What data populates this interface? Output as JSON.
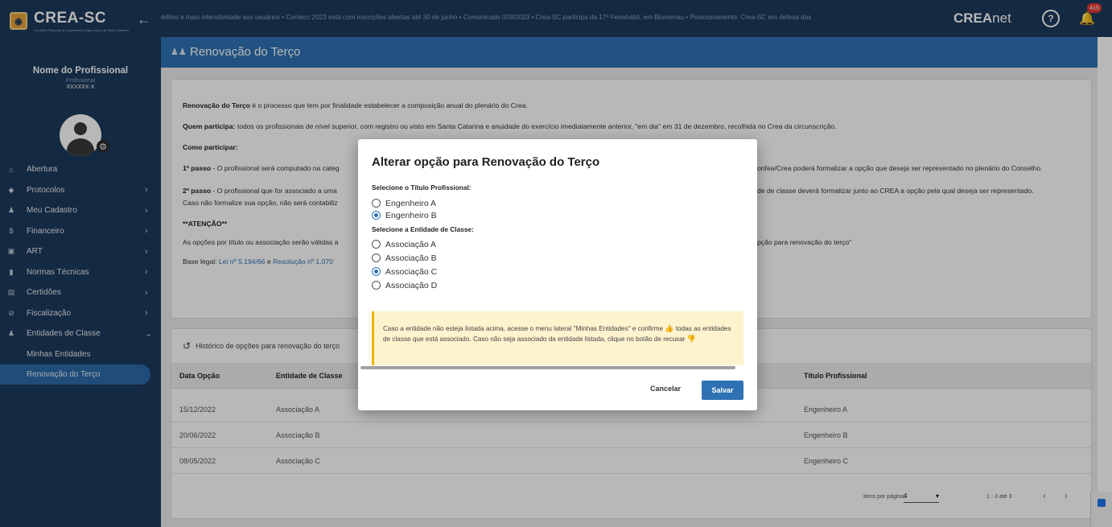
{
  "app": {
    "brand_logo": "CREA-SC",
    "brand_subtitle": "Conselho Regional de Engenharia e Agronomia de Santa Catarina"
  },
  "header": {
    "ticker": "éditos e mais interatividade aos usuários • Contecc 2023 está com inscrições abertas até 30 de junho • Comunicado 003/2023 • Crea-SC participa da 17ª Fenahabit, em Blumenau • Posicionamento: Crea-SC em defesa dos",
    "brand_bold": "CREA",
    "brand_light": "net",
    "notification_count": "415"
  },
  "profile": {
    "name": "Nome do Profissional",
    "role": "Profissional",
    "registration": "XXXXXX-X"
  },
  "sidebar": {
    "items": [
      {
        "label": "Abertura",
        "icon": "home-icon"
      },
      {
        "label": "Protocolos",
        "icon": "diamond-icon"
      },
      {
        "label": "Meu Cadastro",
        "icon": "user-icon"
      },
      {
        "label": "Financeiro",
        "icon": "dollar-icon"
      },
      {
        "label": "ART",
        "icon": "document-icon"
      },
      {
        "label": "Normas Técnicas",
        "icon": "file-icon"
      },
      {
        "label": "Certidões",
        "icon": "certificate-icon"
      },
      {
        "label": "Fiscalização",
        "icon": "compass-icon"
      },
      {
        "label": "Entidades de Classe",
        "icon": "group-icon"
      }
    ],
    "subitems": [
      "Minhas Entidades",
      "Renovação do Terço"
    ]
  },
  "page": {
    "title": "Renovação do Terço"
  },
  "info": {
    "p1_bold": "Renovação do Terço",
    "p1": " é o processo que tem por finalidade estabelecer a composição anual do plenário do Crea.",
    "p2_bold": "Quem participa:",
    "p2": " todos os profissionais de nível superior, com registro ou visto em Santa Catarina e anuidade do exercício imediatamente anterior, \"em dia\" em 31 de dezembro, recolhida no Crea da circunscrição.",
    "p3_bold": "Como participar:",
    "p4_bold": "1º passo",
    "p4a": " - O profissional será computado na categ",
    "p4b": "onfea/Crea poderá formalizar a opção que deseja ser representado no plenário do Conselho.",
    "p5_bold": "2º passo",
    "p5a": " - O profissional que for associado a uma",
    "p5b": "de de classe deverá formalizar junto ao CREA a opção pela qual deseja ser representado.",
    "p6": "Caso não formalize sua opção, não será contabiliz",
    "p7_bold": "**ATENÇÃO**",
    "p8a": "As opções por título ou associação serão válidas a",
    "p8b": "pção para renovação do terço\"",
    "p9a": "Base legal: ",
    "p9_link1": "Lei nº 5.194/66",
    "p9_mid": " e ",
    "p9_link2": "Resolução nº 1.070"
  },
  "history": {
    "title": "Histórico de opções para renovação do terço",
    "columns": [
      "Data Opção",
      "Entidade de Classe",
      "Título Profissional"
    ],
    "rows": [
      {
        "date": "15/12/2022",
        "entity": "Associação A",
        "title": "Engenheiro A"
      },
      {
        "date": "20/06/2022",
        "entity": "Associação B",
        "title": "Engenheiro B"
      },
      {
        "date": "08/05/2022",
        "entity": "Associação C",
        "title": "Engenheiro C"
      }
    ],
    "pager": {
      "items_label": "Itens por página:",
      "page_size": "4",
      "range": "1 - 3 até 3"
    }
  },
  "modal": {
    "title": "Alterar opção para Renovação do Terço",
    "title_label": "Selecione o Título Profissional:",
    "titles": [
      {
        "label": "Engenheiro A",
        "selected": false
      },
      {
        "label": "Engenheiro B",
        "selected": true
      }
    ],
    "entity_label": "Selecione a Entidade de Classe:",
    "entities": [
      {
        "label": "Associação A",
        "selected": false
      },
      {
        "label": "Associação B",
        "selected": false
      },
      {
        "label": "Associação C",
        "selected": true
      },
      {
        "label": "Associação D",
        "selected": false
      }
    ],
    "alert_a": "Caso a entidade não esteja listada acima, acesse o menu lateral \"Minhas Entidades\" e confirme ",
    "alert_b": " todas as entidades de classe que está associado. Caso não seja associado da entidade listada, clique no botão de recusar ",
    "cancel_label": "Cancelar",
    "save_label": "Salvar"
  },
  "colors": {
    "sidebar": "#1d3a5c",
    "accent": "#2f72b3",
    "alert_bg": "#fdf3cf",
    "alert_border": "#f0b400"
  }
}
